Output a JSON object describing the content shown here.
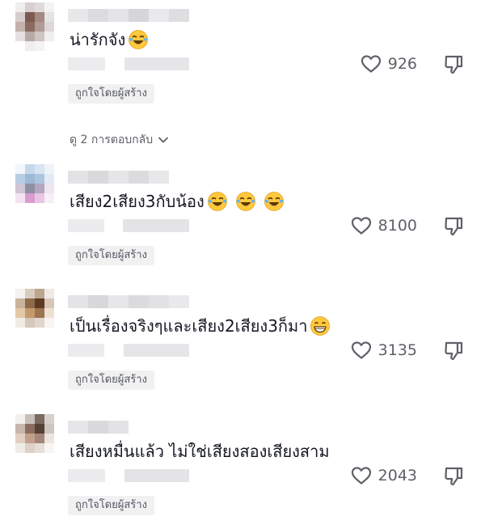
{
  "comments": [
    {
      "text": "น่ารักจัง",
      "emojis": [
        "tears-of-joy-emoji"
      ],
      "likes": "926",
      "badge": "ถูกใจโดยผู้สร้าง",
      "replies_label": "ดู 2 การตอบกลับ"
    },
    {
      "text": "เสียง2เสียง3กับน้อง",
      "emojis": [
        "tears-of-joy-emoji",
        "tears-of-joy-emoji",
        "tears-of-joy-emoji"
      ],
      "likes": "8100",
      "badge": "ถูกใจโดยผู้สร้าง"
    },
    {
      "text": "เป็นเรื่องจริงๆและเสียง2เสียง3ก็มา",
      "emojis": [
        "grinning-emoji"
      ],
      "likes": "3135",
      "badge": "ถูกใจโดยผู้สร้าง"
    },
    {
      "text": "เสียงหมื่นแล้ว ไม่ใช่เสียงสองเสียงสาม",
      "emojis": [],
      "likes": "2043",
      "badge": "ถูกใจโดยผู้สร้าง"
    }
  ],
  "colors": {
    "text": "#161823",
    "secondary": "#5f6068",
    "badge_bg": "#f1f1f2",
    "emoji_face": "#ffc83d",
    "emoji_tears": "#5ab4ff"
  }
}
